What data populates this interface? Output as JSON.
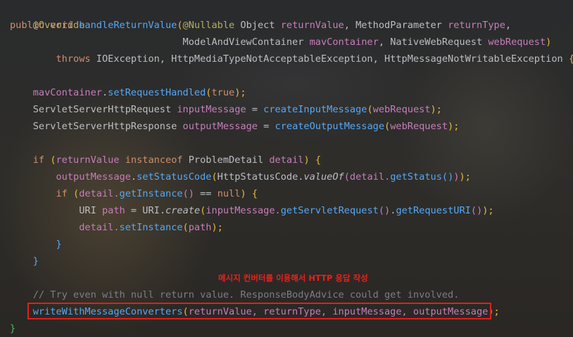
{
  "code": {
    "l1_override": "@Override",
    "l2": {
      "public": "public ",
      "void": "void ",
      "method": "handleReturnValue",
      "paren": "(",
      "nullable": "@Nullable",
      "objtype": " Object ",
      "returnValue": "returnValue",
      "comma": ", ",
      "mptype": "MethodParameter ",
      "returnType": "returnType",
      "trail": ","
    },
    "l3": {
      "indent": "                              ",
      "mavType": "ModelAndViewContainer ",
      "mavContainer": "mavContainer",
      "comma": ", ",
      "nwrType": "NativeWebRequest ",
      "webRequest": "webRequest",
      "close": ")"
    },
    "l4": {
      "indent": "        ",
      "throws": "throws ",
      "exceptions": "IOException, HttpMediaTypeNotAcceptableException, HttpMessageNotWritableException ",
      "brace": "{"
    },
    "l6": {
      "indent": "    ",
      "obj": "mavContainer",
      "dot": ".",
      "call": "setRequestHandled",
      "paren": "(",
      "true": "true",
      "close": ");"
    },
    "l7": {
      "indent": "    ",
      "type": "ServletServerHttpRequest ",
      "var": "inputMessage",
      "eq": " = ",
      "call": "createInputMessage",
      "paren": "(",
      "arg": "webRequest",
      "close": ");"
    },
    "l8": {
      "indent": "    ",
      "type": "ServletServerHttpResponse ",
      "var": "outputMessage",
      "eq": " = ",
      "call": "createOutputMessage",
      "paren": "(",
      "arg": "webRequest",
      "close": ");"
    },
    "l10": {
      "indent": "    ",
      "if": "if ",
      "paren": "(",
      "returnValue": "returnValue ",
      "instanceof": "instanceof ",
      "type": "ProblemDetail ",
      "detail": "detail",
      "close": ") ",
      "brace": "{"
    },
    "l11": {
      "indent": "        ",
      "obj": "outputMessage",
      "dot": ".",
      "call": "setStatusCode",
      "paren": "(",
      "cls": "HttpStatusCode.",
      "valueOf": "valueOf",
      "paren2": "(",
      "detail": "detail.",
      "getStatus": "getStatus",
      "inner": "()",
      "close2": ")",
      "close": ");"
    },
    "l12": {
      "indent": "        ",
      "if": "if ",
      "paren": "(",
      "detail": "detail.",
      "getInstance": "getInstance",
      "inner": "()",
      "eq": " == ",
      "null": "null",
      "close": ") ",
      "brace": "{"
    },
    "l13": {
      "indent": "            ",
      "type": "URI ",
      "var": "path",
      "eq": " = ",
      "cls": "URI.",
      "create": "create",
      "paren": "(",
      "input": "inputMessage.",
      "gsr": "getServletRequest",
      "p1": "()",
      "dot": ".",
      "gru": "getRequestURI",
      "p2": "()",
      "close": ");"
    },
    "l14": {
      "indent": "            ",
      "detail": "detail.",
      "call": "setInstance",
      "paren": "(",
      "arg": "path",
      "close": ");"
    },
    "l15": {
      "indent": "        ",
      "brace": "}"
    },
    "l16": {
      "indent": "    ",
      "brace": "}"
    },
    "l18": {
      "indent": "    ",
      "comment": "// Try even with null return value. ResponseBodyAdvice could get involved."
    },
    "l19": {
      "indent": "    ",
      "call": "writeWithMessageConverters",
      "paren": "(",
      "args": "returnValue, returnType, inputMessage, outputMessage",
      "close": ");"
    },
    "l20": {
      "brace": "}"
    }
  },
  "annotation": {
    "note_text": "메시지 컨버터를 이용해서 HTTP 응답 작성"
  },
  "colors": {
    "keyword": "#cf8e6d",
    "annotation": "#b3ae60",
    "method": "#56a8f5",
    "parameter": "#c77dbb",
    "comment": "#7a7e85",
    "highlight_border": "#e0201b"
  }
}
